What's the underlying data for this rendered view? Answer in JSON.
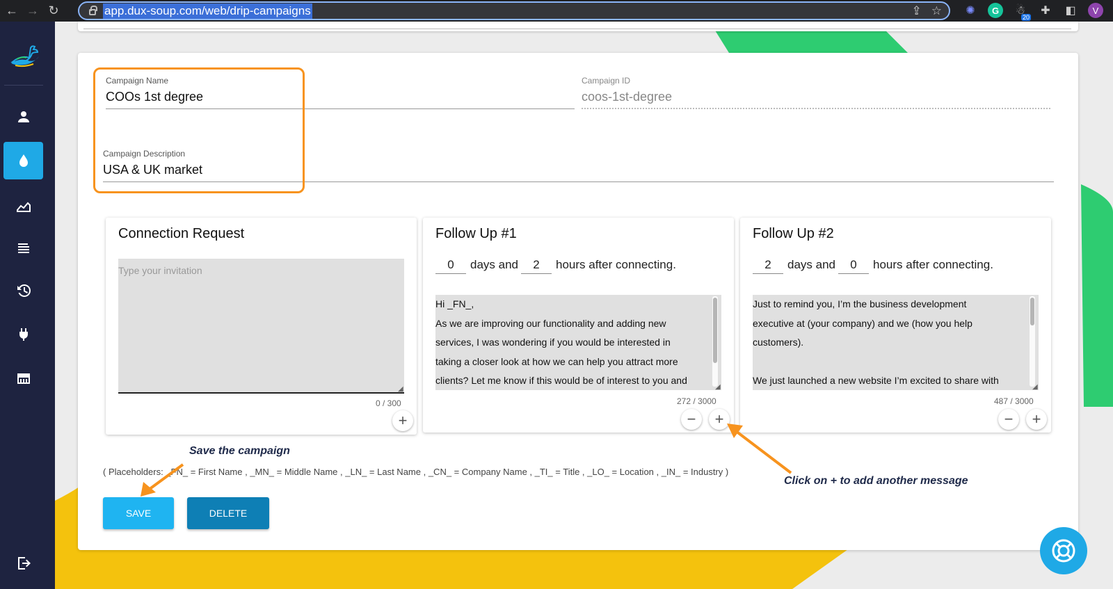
{
  "browser": {
    "url": "app.dux-soup.com/web/drip-campaigns",
    "extension_badge": "20",
    "profile_initial": "V",
    "grammarly_letter": "G"
  },
  "sidebar": {
    "items": [
      {
        "icon": "person-icon"
      },
      {
        "icon": "drop-icon",
        "active": true
      },
      {
        "icon": "chart-area-icon"
      },
      {
        "icon": "list-icon"
      },
      {
        "icon": "history-icon"
      },
      {
        "icon": "plug-icon"
      },
      {
        "icon": "store-icon"
      },
      {
        "icon": "logout-icon"
      }
    ]
  },
  "campaign": {
    "name_label": "Campaign Name",
    "name_value": "COOs 1st degree",
    "id_label": "Campaign ID",
    "id_value": "coos-1st-degree",
    "description_label": "Campaign Description",
    "description_value": "USA & UK market"
  },
  "messages": [
    {
      "title": "Connection Request",
      "placeholder": "Type your invitation",
      "counter": "0 / 300",
      "add_label": "+"
    },
    {
      "title": "Follow Up #1",
      "days": "0",
      "days_word": "days and",
      "hours": "2",
      "hours_word": "hours after connecting.",
      "body_lines": [
        "Hi _FN_,",
        "As we are improving our functionality and adding new",
        "services, I was wondering if you would be interested in",
        "taking a closer look at how we can help you attract more",
        "clients? Let me know if this would be of interest to you and"
      ],
      "counter": "272 / 3000",
      "remove_label": "−",
      "add_label": "+"
    },
    {
      "title": "Follow Up #2",
      "days": "2",
      "days_word": "days and",
      "hours": "0",
      "hours_word": "hours after connecting.",
      "body_lines": [
        "Just to remind you, I’m the business development",
        "executive at (your company) and we (how you help",
        "customers).",
        "",
        "We just launched a new website I’m excited to share with"
      ],
      "counter": "487 / 3000",
      "remove_label": "−",
      "add_label": "+"
    }
  ],
  "placeholders_text": "( Placeholders: _FN_ = First Name , _MN_ = Middle Name , _LN_ = Last Name , _CN_ = Company Name , _TI_ = Title , _LO_ = Location , _IN_ = Industry )",
  "buttons": {
    "save": "SAVE",
    "delete": "DELETE"
  },
  "annotations": {
    "save_note": "Save the campaign",
    "add_note": "Click on + to add another message"
  },
  "colors": {
    "sidebar_bg": "#1e2340",
    "accent": "#1fa9e6",
    "highlight": "#f7931e",
    "save_button": "#1fb4f1",
    "delete_button": "#0e7fb5",
    "deco_green": "#2ecc71",
    "deco_yellow": "#f4c20d"
  }
}
